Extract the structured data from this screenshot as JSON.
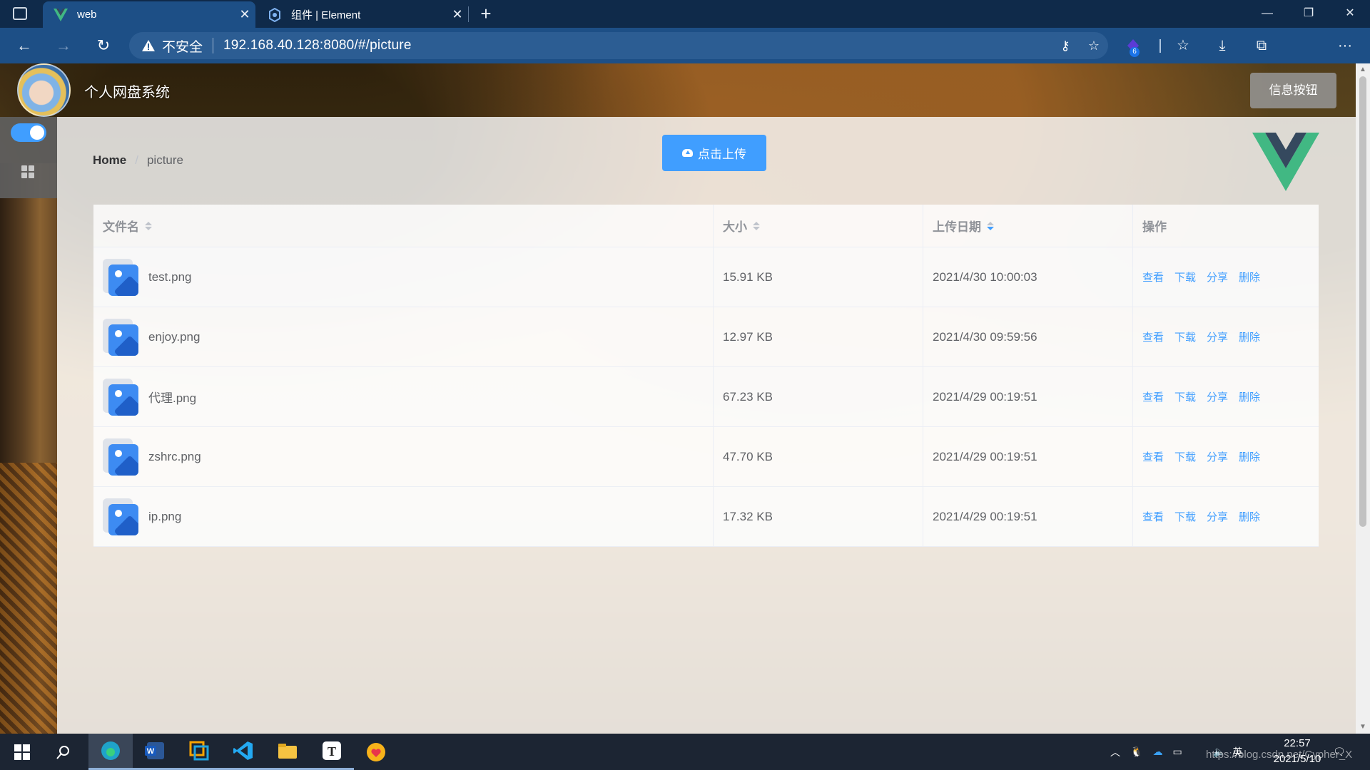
{
  "browser": {
    "tabs": [
      {
        "title": "web",
        "icon": "vue-logo-icon",
        "active": true
      },
      {
        "title": "组件 | Element",
        "icon": "element-logo-icon",
        "active": false
      }
    ],
    "new_tab_icon": "plus-icon",
    "window_controls": [
      "minimize-icon",
      "restore-icon",
      "close-icon"
    ],
    "address": {
      "security_label": "不安全",
      "url": "192.168.40.128:8080/#/picture"
    },
    "extension_badge": "6"
  },
  "app": {
    "title": "个人网盘系统",
    "info_button": "信息按钮",
    "colors": {
      "accent": "#409eff",
      "sidebar": "#5f5f5f"
    },
    "sidebar": {
      "toggle_on": true,
      "menu_icon": "grid-icon"
    }
  },
  "breadcrumb": {
    "home": "Home",
    "separator": "/",
    "current": "picture"
  },
  "upload_button": "点击上传",
  "table": {
    "columns": [
      {
        "label": "文件名",
        "sortable": true,
        "sort": "none"
      },
      {
        "label": "大小",
        "sortable": true,
        "sort": "none"
      },
      {
        "label": "上传日期",
        "sortable": true,
        "sort": "descending"
      },
      {
        "label": "操作",
        "sortable": false
      }
    ],
    "rows": [
      {
        "name": "test.png",
        "size": "15.91 KB",
        "date": "2021/4/30 10:00:03"
      },
      {
        "name": "enjoy.png",
        "size": "12.97 KB",
        "date": "2021/4/30 09:59:56"
      },
      {
        "name": "代理.png",
        "size": "67.23 KB",
        "date": "2021/4/29 00:19:51"
      },
      {
        "name": "zshrc.png",
        "size": "47.70 KB",
        "date": "2021/4/29 00:19:51"
      },
      {
        "name": "ip.png",
        "size": "17.32 KB",
        "date": "2021/4/29 00:19:51"
      }
    ],
    "actions": [
      "查看",
      "下载",
      "分享",
      "删除"
    ]
  },
  "taskbar": {
    "apps": [
      "edge-icon",
      "word-icon",
      "vmware-icon",
      "vscode-icon",
      "file-explorer-icon",
      "typora-icon",
      "heart-app-icon"
    ],
    "tray": {
      "input_method": "英",
      "volume_icon": "speaker-icon"
    },
    "clock": {
      "time": "22:57",
      "date": "2021/5/10"
    }
  },
  "watermark": "https://blog.csdn.net/Cypher_X"
}
